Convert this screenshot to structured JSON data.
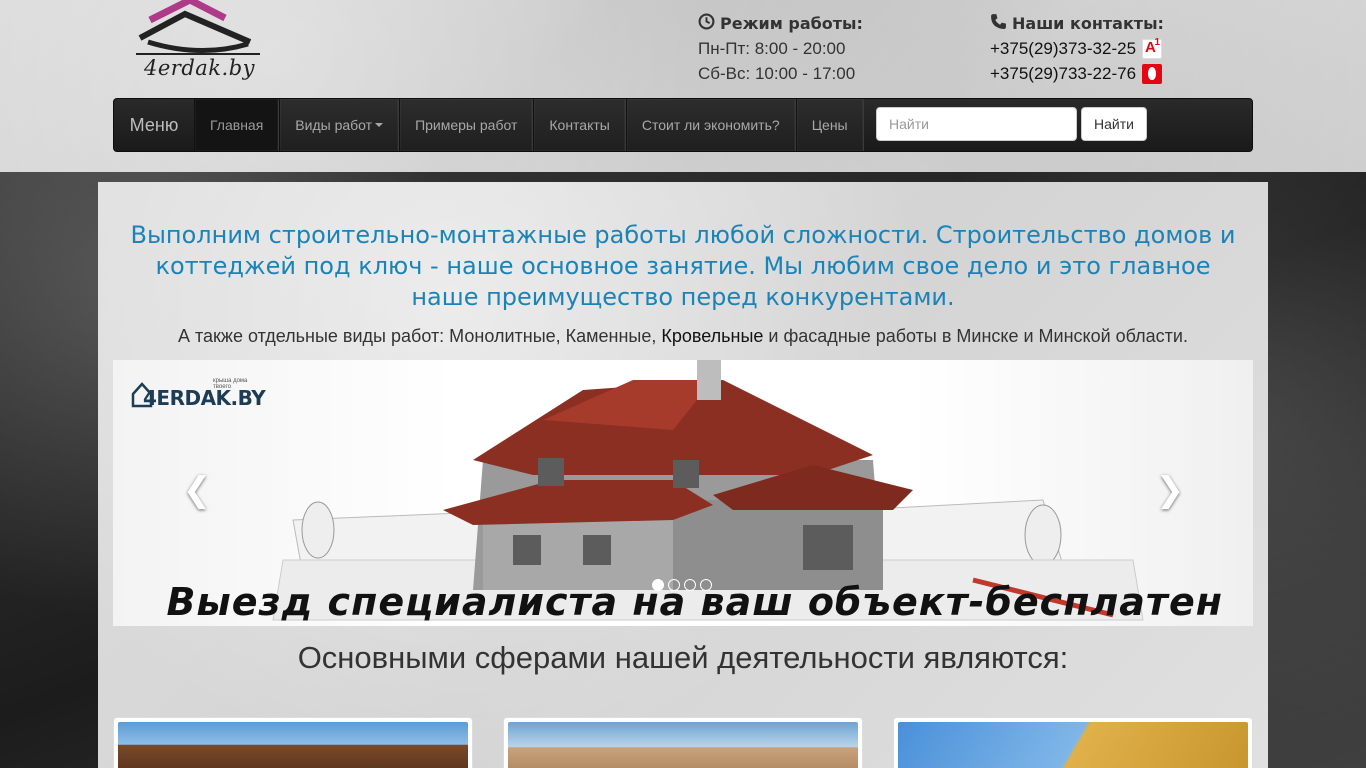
{
  "header": {
    "logo_text": "4erdak.by",
    "hours": {
      "title": "Режим работы:",
      "weekdays": "Пн-Пт: 8:00 - 20:00",
      "weekend": "Сб-Вс: 10:00 - 17:00"
    },
    "contacts": {
      "title": "Наши контакты:",
      "phone_a1": "+375(29)373-32-25",
      "phone_mts": "+375(29)733-22-76"
    }
  },
  "nav": {
    "brand": "Меню",
    "items": [
      {
        "label": "Главная"
      },
      {
        "label": "Виды работ"
      },
      {
        "label": "Примеры работ"
      },
      {
        "label": "Контакты"
      },
      {
        "label": "Стоит ли экономить?"
      },
      {
        "label": "Цены"
      }
    ],
    "search_placeholder": "Найти",
    "search_button": "Найти"
  },
  "main": {
    "headline": "Выполним строительно-монтажные работы любой сложности. Строительство домов и коттеджей под ключ - наше основное занятие. Мы любим свое дело и это главное наше преимущество перед конкурентами.",
    "subline_before": "А также отдельные виды работ: Монолитные, Каменные, ",
    "subline_link": "Кровельные",
    "subline_after": " и фасадные работы в Минске и Минской области.",
    "carousel": {
      "logo_text": "4ERDAK.BY",
      "logo_tag": "крыша дома твоего",
      "caption": "Выезд специалиста на ваш объект-бесплатен",
      "slides_count": 4,
      "active_slide": 1
    },
    "section_title": "Основными сферами нашей деятельности являются:"
  },
  "colors": {
    "accent_blue": "#1a84b8",
    "navbar": "#1f1f1f",
    "logo_pink": "#b03a8a"
  }
}
